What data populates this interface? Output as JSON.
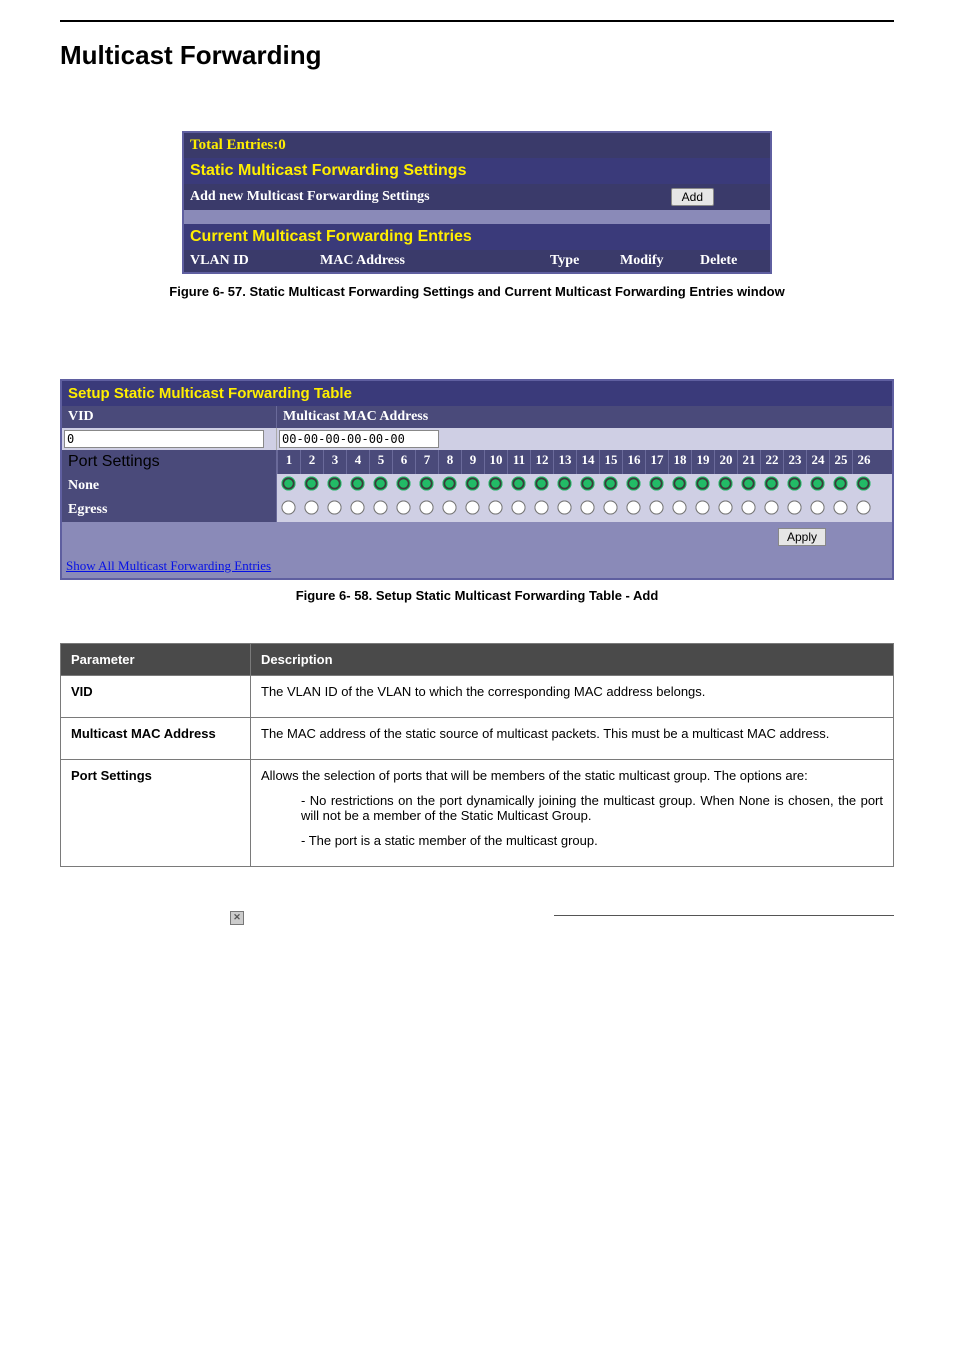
{
  "heading": "Multicast Forwarding",
  "panel1": {
    "total": "Total Entries:0",
    "header1": "Static Multicast Forwarding Settings",
    "addRowLabel": "Add new Multicast Forwarding Settings",
    "addBtn": "Add",
    "header2": "Current Multicast Forwarding Entries",
    "cols": {
      "c1": "VLAN ID",
      "c2": "MAC Address",
      "c3": "Type",
      "c4": "Modify",
      "c5": "Delete"
    }
  },
  "figcap1": "Figure 6- 57. Static Multicast Forwarding Settings and Current Multicast Forwarding Entries window",
  "panel2": {
    "header": "Setup Static Multicast Forwarding Table",
    "vidLabel": "VID",
    "macLabel": "Multicast MAC Address",
    "vidValue": "0",
    "macValue": "00-00-00-00-00-00",
    "portSettings": "Port Settings",
    "noneLabel": "None",
    "egressLabel": "Egress",
    "ports": [
      "1",
      "2",
      "3",
      "4",
      "5",
      "6",
      "7",
      "8",
      "9",
      "10",
      "11",
      "12",
      "13",
      "14",
      "15",
      "16",
      "17",
      "18",
      "19",
      "20",
      "21",
      "22",
      "23",
      "24",
      "25",
      "26"
    ],
    "applyBtn": "Apply",
    "linkText": "Show All Multicast Forwarding Entries"
  },
  "figcap2": "Figure 6- 58. Setup Static Multicast Forwarding Table - Add",
  "paramTable": {
    "headParam": "Parameter",
    "headDesc": "Description",
    "rows": [
      {
        "name": "VID",
        "desc1": "The VLAN ID of the VLAN to which the corresponding MAC address belongs."
      },
      {
        "name": "Multicast MAC Address",
        "desc1": "The MAC address of the static source of multicast packets. This must be a multicast MAC address."
      },
      {
        "name": "Port Settings",
        "desc1": "Allows the selection of ports that will be members of the static multicast group. The options are:",
        "note1": "- No restrictions on the port dynamically joining the multicast group. When None is chosen, the port will not be a member of the Static Multicast Group.",
        "note2": "- The port is a static member of the multicast group."
      }
    ]
  },
  "footerIcon": "✕"
}
